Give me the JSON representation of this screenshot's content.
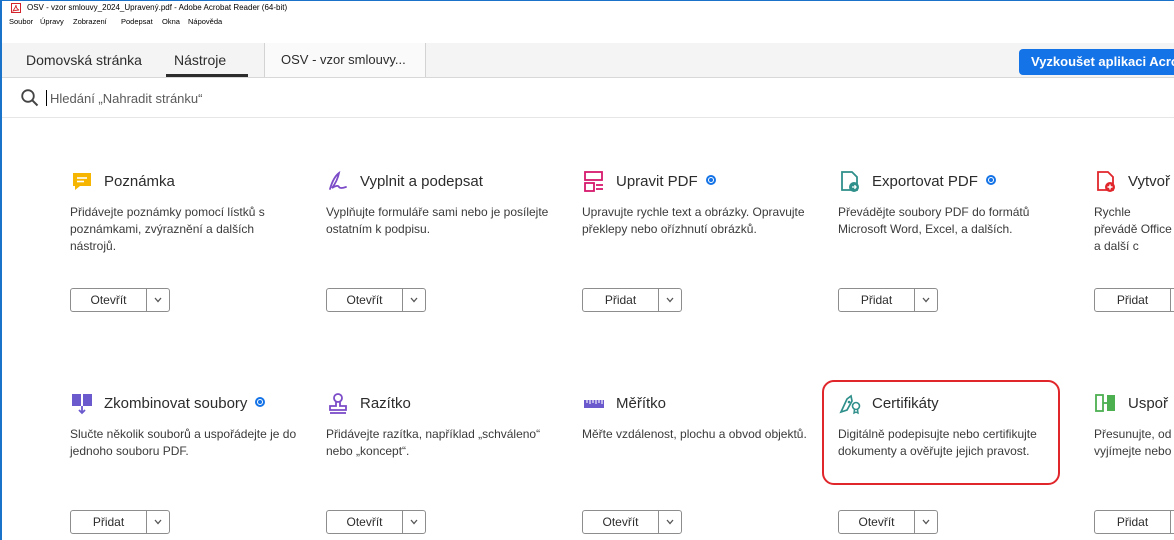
{
  "window": {
    "title": "OSV - vzor smlouvy_2024_Upravený.pdf - Adobe Acrobat Reader (64-bit)"
  },
  "menu": [
    "Soubor",
    "Úpravy",
    "Zobrazení",
    "Podepsat",
    "Okna",
    "Nápověda"
  ],
  "tabs": {
    "home": "Domovská stránka",
    "tools": "Nástroje",
    "document": "OSV - vzor smlouvy..."
  },
  "try_button": "Vyzkoušet aplikaci Acrobat",
  "search": {
    "placeholder": "Hledání „Nahradit stránku“"
  },
  "colors": {
    "accent": "#1473e6",
    "highlight": "#e0262b"
  },
  "tools": [
    {
      "icon": "comment-icon",
      "title": "Poznámka",
      "premium": false,
      "description": "Přidávejte poznámky pomocí lístků s poznámkami, zvýraznění a dalších nástrojů.",
      "button": "Otevřít"
    },
    {
      "icon": "fill-sign-icon",
      "title": "Vyplnit a podepsat",
      "premium": false,
      "description": "Vyplňujte formuláře sami nebo je posílejte ostatním k podpisu.",
      "button": "Otevřít"
    },
    {
      "icon": "edit-pdf-icon",
      "title": "Upravit PDF",
      "premium": true,
      "description": "Upravujte rychle text a obrázky. Opravujte překlepy nebo ořízhnutí obrázků.",
      "button": "Přidat"
    },
    {
      "icon": "export-pdf-icon",
      "title": "Exportovat PDF",
      "premium": true,
      "description": "Převádějte soubory PDF do formátů Microsoft Word, Excel, a dalších.",
      "button": "Přidat"
    },
    {
      "icon": "create-pdf-icon",
      "title": "Vytvoř",
      "premium": false,
      "description": "Rychle převádě Office a další c",
      "button": "Přidat"
    },
    {
      "icon": "combine-files-icon",
      "title": "Zkombinovat soubory",
      "premium": true,
      "description": "Slučte několik souborů a uspořádejte je do jednoho souboru PDF.",
      "button": "Přidat"
    },
    {
      "icon": "stamp-icon",
      "title": "Razítko",
      "premium": false,
      "description": "Přidávejte razítka, například „schváleno“ nebo „koncept“.",
      "button": "Otevřít"
    },
    {
      "icon": "ruler-icon",
      "title": "Měřítko",
      "premium": false,
      "description": "Měřte vzdálenost, plochu a obvod objektů.",
      "button": "Otevřít"
    },
    {
      "icon": "certificate-pen-icon",
      "title": "Certifikáty",
      "premium": false,
      "description": "Digitálně podepisujte nebo certifikujte dokumenty a ověřujte jejich pravost.",
      "button": "Otevřít"
    },
    {
      "icon": "organize-pages-icon",
      "title": "Uspoř",
      "premium": false,
      "description": "Přesunujte, od vyjímejte nebo",
      "button": "Přidat"
    }
  ]
}
